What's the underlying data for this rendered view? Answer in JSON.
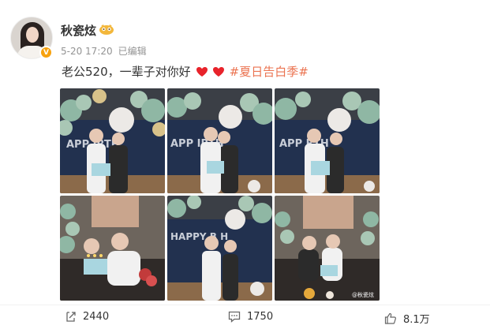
{
  "post": {
    "author": "秋瓷炫",
    "verified_badge": "V",
    "date": "5-20 17:20",
    "edited": "已编辑",
    "text": "老公520，一辈子对你好",
    "topic": "#夏日告白季#",
    "watermark": "@秋瓷炫"
  },
  "photos": [
    {
      "scene": "balloon-arch-couple-cake"
    },
    {
      "scene": "balloon-arch-kiss"
    },
    {
      "scene": "balloon-arch-couple-cake-closeup"
    },
    {
      "scene": "sofa-candles-cake"
    },
    {
      "scene": "balloon-arch-standing"
    },
    {
      "scene": "sofa-couple-cake"
    }
  ],
  "actions": {
    "share_count": "2440",
    "comment_count": "1750",
    "like_count": "8.1万"
  },
  "colors": {
    "link": "#eb7350",
    "heart": "#e8232b",
    "meta": "#939393",
    "balloon_green": "#8fb7a4",
    "badge_orange": "#f7a20f"
  },
  "icons": [
    "share-icon",
    "comment-icon",
    "like-icon",
    "heart-icon",
    "verified-badge-icon",
    "user-level-icon"
  ]
}
